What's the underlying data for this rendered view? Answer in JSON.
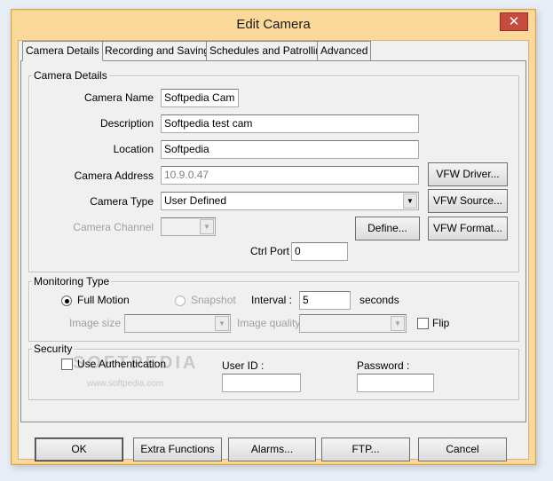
{
  "window": {
    "title": "Edit Camera",
    "close_glyph": "✕"
  },
  "tabs": [
    {
      "label": "Camera Details",
      "active": true
    },
    {
      "label": "Recording and Saving",
      "active": false
    },
    {
      "label": "Schedules and Patrolling",
      "active": false
    },
    {
      "label": "Advanced",
      "active": false
    }
  ],
  "camera_details": {
    "group_label": "Camera Details",
    "camera_name": {
      "label": "Camera Name",
      "value": "Softpedia Cam"
    },
    "description": {
      "label": "Description",
      "value": "Softpedia test cam"
    },
    "location": {
      "label": "Location",
      "value": "Softpedia"
    },
    "camera_address": {
      "label": "Camera Address",
      "value": "10.9.0.47"
    },
    "camera_type": {
      "label": "Camera Type",
      "value": "User Defined"
    },
    "camera_channel": {
      "label": "Camera Channel",
      "value": ""
    },
    "ctrl_port": {
      "label": "Ctrl Port",
      "value": "0"
    },
    "buttons": {
      "vfw_driver": "VFW Driver...",
      "vfw_source": "VFW Source...",
      "vfw_format": "VFW Format...",
      "define": "Define..."
    }
  },
  "monitoring": {
    "group_label": "Monitoring Type",
    "full_motion": {
      "label": "Full Motion",
      "selected": true
    },
    "snapshot": {
      "label": "Snapshot",
      "selected": false
    },
    "interval": {
      "label": "Interval :",
      "value": "5",
      "unit": "seconds"
    },
    "image_size": {
      "label": "Image size",
      "value": ""
    },
    "image_quality": {
      "label": "Image quality",
      "value": ""
    },
    "flip": {
      "label": "Flip",
      "checked": false
    }
  },
  "security": {
    "group_label": "Security",
    "use_authentication": {
      "label": "Use Authentication",
      "checked": false
    },
    "user_id": {
      "label": "User ID :",
      "value": ""
    },
    "password": {
      "label": "Password :",
      "value": ""
    }
  },
  "watermark": {
    "text": "SOFTPEDIA",
    "sub": "www.softpedia.com"
  },
  "footer": {
    "ok": "OK",
    "extra_functions": "Extra Functions",
    "alarms": "Alarms...",
    "ftp": "FTP...",
    "cancel": "Cancel"
  },
  "icons": {
    "dropdown": "chevron-down-icon",
    "close": "close-icon"
  }
}
